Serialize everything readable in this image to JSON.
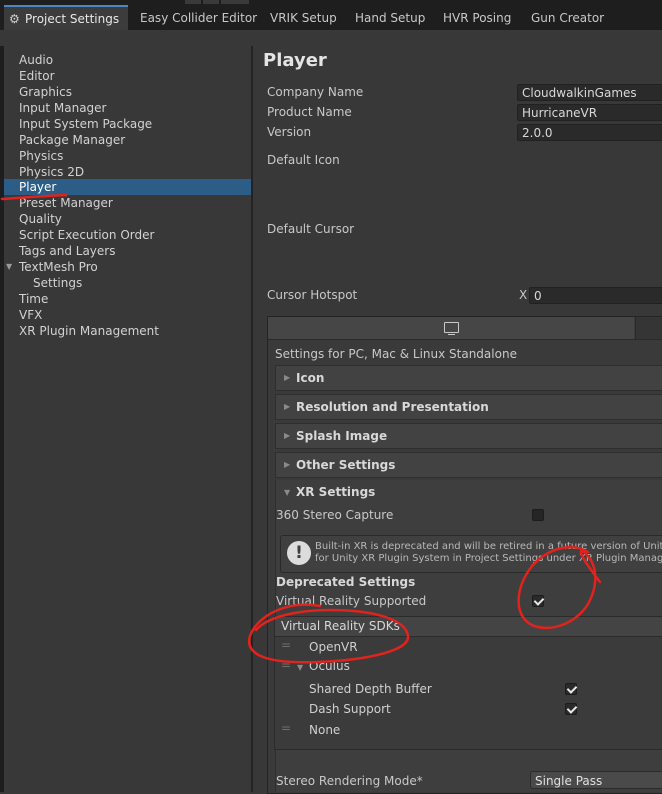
{
  "tabs": [
    {
      "label": "Project Settings",
      "active": true,
      "icon": "gear-icon"
    },
    {
      "label": "Easy Collider Editor"
    },
    {
      "label": "VRIK Setup"
    },
    {
      "label": "Hand Setup"
    },
    {
      "label": "HVR Posing"
    },
    {
      "label": "Gun Creator"
    }
  ],
  "sidebar": {
    "items": [
      {
        "label": "Audio"
      },
      {
        "label": "Editor"
      },
      {
        "label": "Graphics"
      },
      {
        "label": "Input Manager"
      },
      {
        "label": "Input System Package"
      },
      {
        "label": "Package Manager"
      },
      {
        "label": "Physics"
      },
      {
        "label": "Physics 2D"
      },
      {
        "label": "Player",
        "selected": true
      },
      {
        "label": "Preset Manager"
      },
      {
        "label": "Quality"
      },
      {
        "label": "Script Execution Order"
      },
      {
        "label": "Tags and Layers"
      },
      {
        "label": "TextMesh Pro",
        "expanded": true
      },
      {
        "label": "Settings",
        "child": true
      },
      {
        "label": "Time"
      },
      {
        "label": "VFX"
      },
      {
        "label": "XR Plugin Management"
      }
    ]
  },
  "main": {
    "title": "Player",
    "company_label": "Company Name",
    "company_value": "CloudwalkinGames",
    "product_label": "Product Name",
    "product_value": "HurricaneVR",
    "version_label": "Version",
    "version_value": "2.0.0",
    "default_icon_label": "Default Icon",
    "default_cursor_label": "Default Cursor",
    "cursor_hotspot_label": "Cursor Hotspot",
    "hotspot_x_label": "X",
    "hotspot_x_value": "0",
    "platform_title": "Settings for PC, Mac & Linux Standalone",
    "sections": {
      "icon": "Icon",
      "resolution": "Resolution and Presentation",
      "splash": "Splash Image",
      "other": "Other Settings",
      "xr": "XR Settings"
    },
    "xr": {
      "stereo_capture_label": "360 Stereo Capture",
      "stereo_capture_checked": false,
      "help_line1": "Built-in XR is deprecated and will be retired in a future version of Unity. U",
      "help_line2": "for Unity XR Plugin System in Project Settings under XR Plugin Manageme",
      "deprecated_header": "Deprecated Settings",
      "vr_supported_label": "Virtual Reality Supported",
      "vr_supported_checked": true,
      "sdks_header": "Virtual Reality SDKs",
      "sdk_openvr": "OpenVR",
      "sdk_oculus": "Oculus",
      "shared_depth_label": "Shared Depth Buffer",
      "shared_depth_checked": true,
      "dash_label": "Dash Support",
      "dash_checked": true,
      "sdk_none": "None",
      "stereo_mode_label": "Stereo Rendering Mode*",
      "stereo_mode_value": "Single Pass"
    }
  },
  "colors": {
    "accent_selection": "#2c5d87",
    "annotation_red": "#e0231d",
    "panel_bg": "#383838",
    "tab_bar_bg": "#1e1e1e"
  }
}
